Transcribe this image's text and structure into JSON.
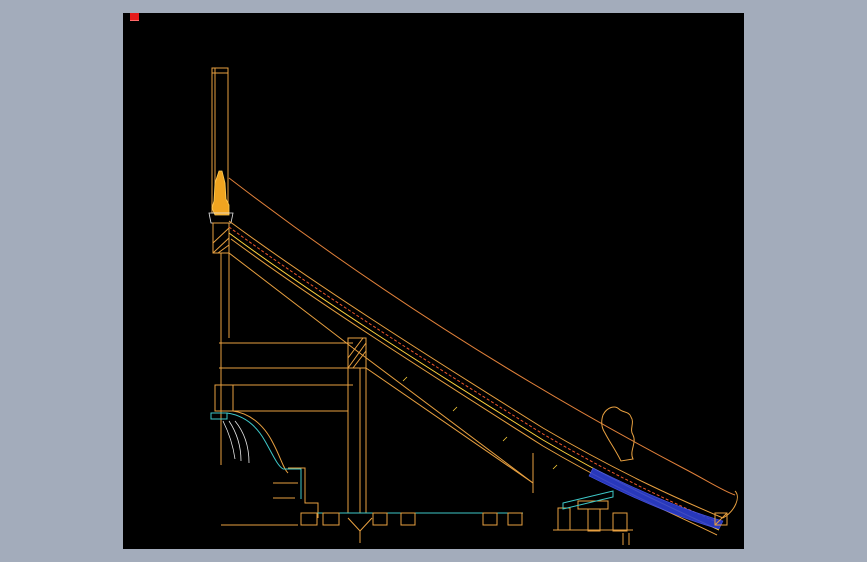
{
  "app": {
    "viewport_background": "#000000",
    "page_background": "#a3acbb"
  },
  "drawing": {
    "subject": "roof-eave-section",
    "colors": {
      "structure": "#e8a040",
      "ornament_fill": "#f0a420",
      "tile_line": "#ffd23c",
      "curve_red": "#f05a2a",
      "blue_layer": "#2d3fd0",
      "cyan_detail": "#3ec8c8",
      "white_detail": "#e8e8e8",
      "ucs_marker": "#e51b1b"
    }
  }
}
